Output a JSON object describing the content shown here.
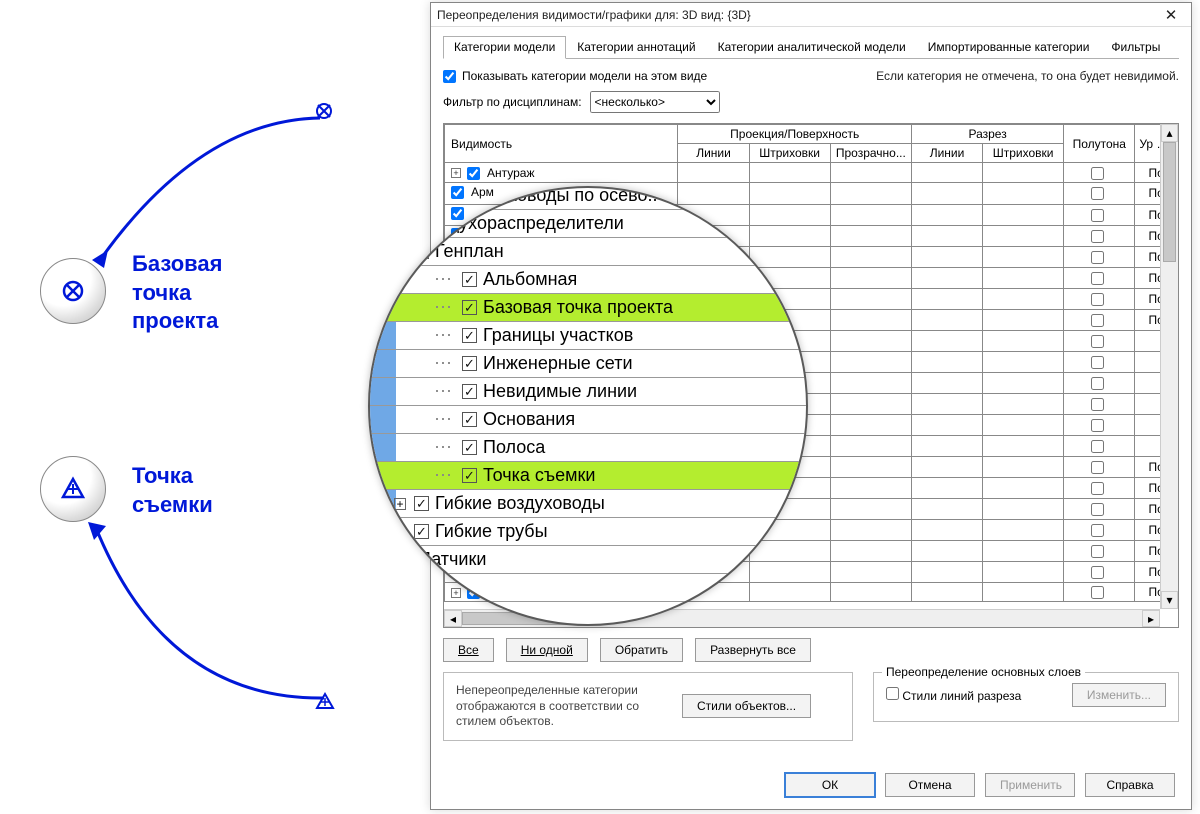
{
  "left": {
    "project_point_label": "Базовая\nточка\nпроекта",
    "survey_point_label": "Точка\nсъемки"
  },
  "dialog": {
    "title": "Переопределения видимости/графики для: 3D вид: {3D}",
    "tabs": [
      "Категории модели",
      "Категории аннотаций",
      "Категории аналитической модели",
      "Импортированные категории",
      "Фильтры"
    ],
    "cb_show_label": "Показывать категории модели на этом виде",
    "hint": "Если категория не отмечена, то она будет невидимой.",
    "filter_label": "Фильтр по дисциплинам:",
    "filter_value": "<несколько>",
    "columns": {
      "visibility": "Видимость",
      "proj_group": "Проекция/Поверхность",
      "proj_lines": "Линии",
      "proj_hatch": "Штриховки",
      "proj_trans": "Прозрачно...",
      "cut_group": "Разрез",
      "cut_lines": "Линии",
      "cut_hatch": "Штриховки",
      "halftone": "Полутона",
      "detail": "Ур дет"
    },
    "rows": [
      {
        "expand": "+",
        "indent": 0,
        "label": "Антураж",
        "po": "По"
      },
      {
        "expand": "",
        "indent": 0,
        "label": "Арм",
        "po": "По"
      },
      {
        "expand": "",
        "indent": 0,
        "label": "",
        "po": "По"
      },
      {
        "expand": "",
        "indent": 0,
        "label": "",
        "po": "По"
      },
      {
        "expand": "",
        "indent": 0,
        "label": "",
        "po": "По"
      },
      {
        "expand": "",
        "indent": 0,
        "label": "",
        "po": "По"
      },
      {
        "expand": "",
        "indent": 0,
        "label": "",
        "po": "По"
      },
      {
        "expand": "",
        "indent": 0,
        "label": "",
        "po": "По"
      },
      {
        "expand": "",
        "indent": 0,
        "label": "",
        "po": ""
      },
      {
        "expand": "",
        "indent": 0,
        "label": "",
        "po": ""
      },
      {
        "expand": "",
        "indent": 0,
        "label": "",
        "po": ""
      },
      {
        "expand": "",
        "indent": 0,
        "label": "",
        "po": ""
      },
      {
        "expand": "",
        "indent": 0,
        "label": "",
        "po": ""
      },
      {
        "expand": "",
        "indent": 0,
        "label": "",
        "po": ""
      },
      {
        "expand": "",
        "indent": 0,
        "label": "",
        "po": "По"
      },
      {
        "expand": "",
        "indent": 0,
        "label": "",
        "po": "По"
      },
      {
        "expand": "",
        "indent": 0,
        "label": "",
        "po": "По"
      },
      {
        "expand": "",
        "indent": 0,
        "label": "",
        "po": "По"
      },
      {
        "expand": "",
        "indent": 0,
        "label": "",
        "po": "По"
      },
      {
        "expand": "",
        "indent": 0,
        "label": "",
        "po": "По"
      },
      {
        "expand": "+",
        "indent": 0,
        "label": "",
        "po": "По"
      }
    ],
    "btns": {
      "all": "Все",
      "none": "Ни одной",
      "invert": "Обратить",
      "expand": "Развернуть все",
      "obj_styles": "Стили объектов...",
      "modify": "Изменить..."
    },
    "info_note": "Непереопределенные категории отображаются в соответствии со стилем объектов.",
    "fs_title": "Переопределение основных слоев",
    "fs_cb": "Стили линий разреза",
    "footer": {
      "ok": "ОК",
      "cancel": "Отмена",
      "apply": "Применить",
      "help": "Справка"
    }
  },
  "magnifier": {
    "items": [
      {
        "exp": "",
        "indent": 50,
        "label": "Воздуховоды по осево..",
        "dots": true
      },
      {
        "exp": "",
        "indent": 34,
        "label": "Воздухораспределители"
      },
      {
        "exp": "-",
        "indent": 34,
        "label": "Генплан"
      },
      {
        "exp": "",
        "indent": 74,
        "label": "Альбомная",
        "dots": true
      },
      {
        "exp": "",
        "indent": 74,
        "label": "Базовая точка проекта",
        "dots": true,
        "hl": true
      },
      {
        "exp": "",
        "indent": 74,
        "label": "Границы участков",
        "dots": true
      },
      {
        "exp": "",
        "indent": 74,
        "label": "Инженерные сети",
        "dots": true
      },
      {
        "exp": "",
        "indent": 74,
        "label": "Невидимые линии",
        "dots": true
      },
      {
        "exp": "",
        "indent": 74,
        "label": "Основания",
        "dots": true
      },
      {
        "exp": "",
        "indent": 74,
        "label": "Полоса",
        "dots": true
      },
      {
        "exp": "",
        "indent": 74,
        "label": "Точка съемки",
        "dots": true,
        "hl": true
      },
      {
        "exp": "+",
        "indent": 34,
        "label": "Гибкие воздуховоды"
      },
      {
        "exp": "+",
        "indent": 34,
        "label": "Гибкие трубы"
      },
      {
        "exp": "",
        "indent": 34,
        "label": "Датчики"
      },
      {
        "exp": "+",
        "indent": 34,
        "label": ""
      }
    ]
  }
}
